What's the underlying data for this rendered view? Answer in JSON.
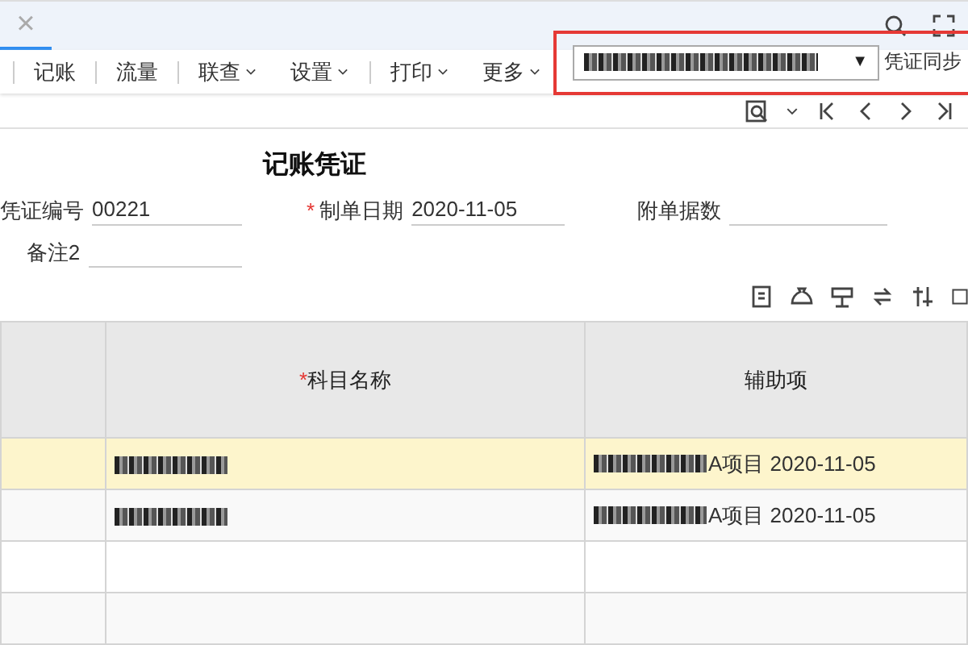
{
  "tab": {
    "close": "×",
    "selected": true
  },
  "toolbar": {
    "items": [
      {
        "label": "记账",
        "kind": "button",
        "separator_before": true
      },
      {
        "label": "流量",
        "kind": "button",
        "separator_before": true
      },
      {
        "label": "联查",
        "kind": "dropdown",
        "separator_before": true
      },
      {
        "label": "设置",
        "kind": "dropdown",
        "separator_before": false
      },
      {
        "label": "打印",
        "kind": "dropdown",
        "separator_before": true
      },
      {
        "label": "更多",
        "kind": "dropdown",
        "separator_before": false
      }
    ],
    "voucher_select": {
      "value_redacted": true,
      "arrow": "▼"
    },
    "sync_label": "凭证同步",
    "highlighted": true
  },
  "form": {
    "title": "记账凭证",
    "fields": [
      {
        "label": "凭证编号",
        "value": "00221"
      },
      {
        "label": "制单日期",
        "value": "2020-11-05",
        "required_mark": "*"
      },
      {
        "label": "附单据数"
      },
      {
        "label": "备注2"
      }
    ]
  },
  "table": {
    "columns": [
      {
        "label": "科目名称",
        "required_mark": "*"
      },
      {
        "label": "辅助项"
      }
    ],
    "rows": [
      {
        "selected": true,
        "account_redacted": true,
        "auxiliary_redacted": true,
        "auxiliary": "A项目 2020-11-05"
      },
      {
        "selected": false,
        "account_redacted": true,
        "auxiliary_redacted": true,
        "auxiliary": "A项目 2020-11-05"
      },
      {
        "selected": false
      },
      {
        "selected": false
      }
    ]
  }
}
